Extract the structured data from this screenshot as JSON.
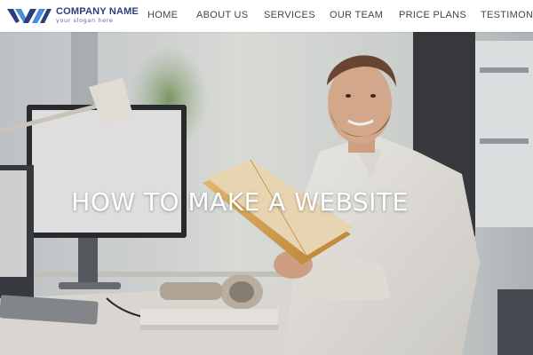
{
  "brand": {
    "name": "COMPANY NAME",
    "slogan": "your slogan here",
    "logo_icon": "double-v-logo-icon",
    "primary_color": "#2c3f7c",
    "accent_color": "#4a8fd6"
  },
  "nav": {
    "items": [
      "HOME",
      "ABOUT US",
      "SERVICES",
      "OUR TEAM",
      "PRICE PLANS",
      "TESTIMONIA"
    ]
  },
  "hero": {
    "title": "HOW TO MAKE A WEBSITE",
    "image": "man-reading-book-at-desk-photo"
  }
}
